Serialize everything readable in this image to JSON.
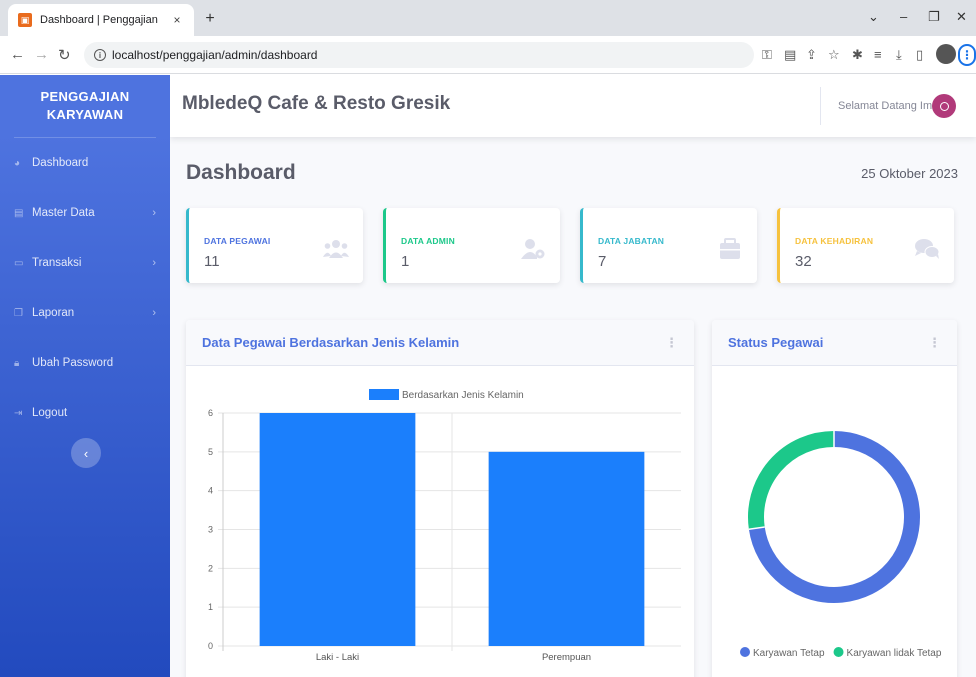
{
  "browser": {
    "tab_title": "Dashboard | Penggajian",
    "tab_close": "×",
    "new_tab": "+",
    "url": "localhost/penggajian/admin/dashboard"
  },
  "sidebar": {
    "brand_line1": "PENGGAJIAN",
    "brand_line2": "KARYAWAN",
    "items": [
      {
        "label": "Dashboard",
        "has_children": false
      },
      {
        "label": "Master Data",
        "has_children": true
      },
      {
        "label": "Transaksi",
        "has_children": true
      },
      {
        "label": "Laporan",
        "has_children": true
      },
      {
        "label": "Ubah Password",
        "has_children": false
      },
      {
        "label": "Logout",
        "has_children": false
      }
    ]
  },
  "topbar": {
    "app_title": "MbledeQ Cafe & Resto Gresik",
    "welcome": "Selamat Datang Ima"
  },
  "page": {
    "title": "Dashboard",
    "date": "25 Oktober 2023"
  },
  "cards": [
    {
      "label": "DATA PEGAWAI",
      "value": "11",
      "color": "#36b9cc",
      "icon": "users-icon"
    },
    {
      "label": "DATA ADMIN",
      "value": "1",
      "color": "#1cc88a",
      "icon": "user-cog-icon"
    },
    {
      "label": "DATA JABATAN",
      "value": "7",
      "color": "#36b9cc",
      "icon": "briefcase-icon"
    },
    {
      "label": "DATA KEHADIRAN",
      "value": "32",
      "color": "#f6c23e",
      "icon": "comments-icon"
    }
  ],
  "panels": {
    "gender_title": "Data Pegawai Berdasarkan Jenis Kelamin",
    "status_title": "Status Pegawai"
  },
  "chart_data": [
    {
      "type": "bar",
      "categories": [
        "Laki - Laki",
        "Perempuan"
      ],
      "series": [
        {
          "name": "Berdasarkan Jenis Kelamin",
          "values": [
            6,
            5
          ],
          "color": "#1b7ffc"
        }
      ],
      "ylim": [
        0,
        6
      ],
      "yticks": [
        0,
        1,
        2,
        3,
        4,
        5,
        6
      ],
      "grid": true,
      "legend": "top"
    },
    {
      "type": "pie",
      "style": "doughnut",
      "labels": [
        "Karyawan Tetap",
        "Karyawan lidak Tetap"
      ],
      "values": [
        8,
        3
      ],
      "colors": [
        "#4e73df",
        "#1cc88a"
      ],
      "legend": "bottom"
    }
  ]
}
